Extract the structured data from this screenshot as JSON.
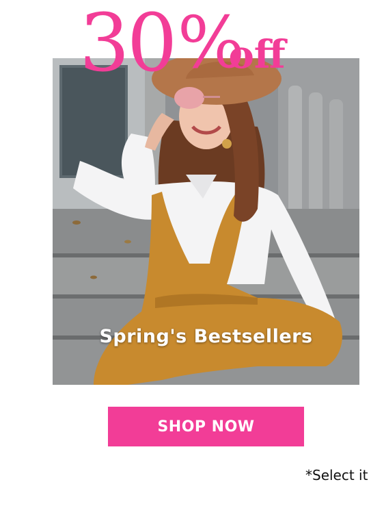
{
  "promo": {
    "headline_number": "30",
    "headline_percent": "%",
    "headline_suffix": "off",
    "caption": "Spring's Bestsellers",
    "cta_label": "SHOP NOW",
    "footnote": "*Select it"
  },
  "colors": {
    "accent": "#f23d97",
    "caption_text": "#ffffff",
    "footnote_text": "#111111"
  },
  "hero_image": {
    "icon": "model-photo"
  }
}
